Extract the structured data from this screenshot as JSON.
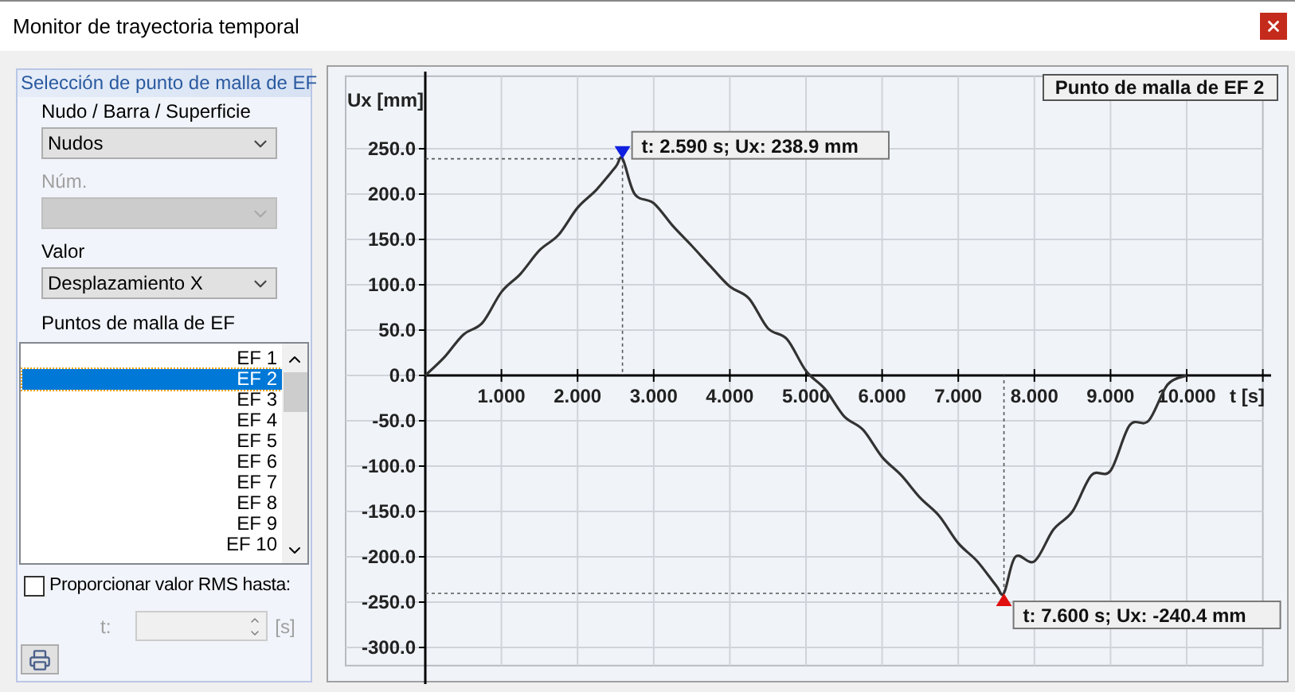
{
  "window": {
    "title": "Monitor de trayectoria temporal"
  },
  "selection_panel": {
    "title": "Selección de punto de malla de EF",
    "fields": [
      {
        "label": "Nudo / Barra / Superficie",
        "value": "Nudos",
        "disabled": false
      },
      {
        "label": "Núm.",
        "disabled": true
      },
      {
        "label": "Valor",
        "value": "Desplazamiento X",
        "disabled": false
      }
    ],
    "list_label": "Puntos de malla de EF",
    "points": [
      {
        "label": "EF 1",
        "selected": false
      },
      {
        "label": "EF 2",
        "selected": true
      },
      {
        "label": "EF 3",
        "selected": false
      },
      {
        "label": "EF 4",
        "selected": false
      },
      {
        "label": "EF 5",
        "selected": false
      },
      {
        "label": "EF 6",
        "selected": false
      },
      {
        "label": "EF 7",
        "selected": false
      },
      {
        "label": "EF 8",
        "selected": false
      },
      {
        "label": "EF 9",
        "selected": false
      },
      {
        "label": "EF 10",
        "selected": false
      }
    ],
    "rms": {
      "label": "Proporcionar valor RMS hasta:",
      "checked": false,
      "field_label": "t:",
      "unit": "[s]",
      "disabled": true
    }
  },
  "chart_panel": {
    "chart_data": {
      "type": "line",
      "title": "Punto de malla de EF 2",
      "xlabel": "t [s]",
      "ylabel": "Ux [mm]",
      "x": [
        0,
        0.25,
        0.5,
        0.75,
        1.0,
        1.25,
        1.5,
        1.75,
        2.0,
        2.25,
        2.5,
        2.59,
        2.75,
        3.0,
        3.25,
        3.5,
        3.75,
        4.0,
        4.25,
        4.5,
        4.75,
        5.0,
        5.25,
        5.5,
        5.75,
        6.0,
        6.25,
        6.5,
        6.75,
        7.0,
        7.25,
        7.5,
        7.6,
        7.75,
        8.0,
        8.25,
        8.5,
        8.75,
        9.0,
        9.25,
        9.5,
        9.75,
        10.0
      ],
      "grid": true,
      "series": [
        {
          "color": "#333333",
          "values": [
            0,
            20,
            45,
            58,
            92,
            112,
            138,
            155,
            185,
            205,
            230,
            239,
            200,
            190,
            165,
            143,
            120,
            98,
            85,
            52,
            40,
            5,
            -15,
            -45,
            -60,
            -90,
            -110,
            -135,
            -155,
            -185,
            -205,
            -232,
            -240,
            -200,
            -205,
            -170,
            -150,
            -110,
            -105,
            -55,
            -50,
            -10,
            0
          ]
        }
      ],
      "xlim": [
        0,
        11
      ],
      "ylim": [
        -320,
        330
      ],
      "xticks": [
        {
          "value": 1,
          "label": "1.000"
        },
        {
          "value": 2,
          "label": "2.000"
        },
        {
          "value": 3,
          "label": "3.000"
        },
        {
          "value": 4,
          "label": "4.000"
        },
        {
          "value": 5,
          "label": "5.000"
        },
        {
          "value": 6,
          "label": "6.000"
        },
        {
          "value": 7,
          "label": "7.000"
        },
        {
          "value": 8,
          "label": "8.000"
        },
        {
          "value": 9,
          "label": "9.000"
        },
        {
          "value": 10,
          "label": "10.000"
        }
      ],
      "yticks": [
        {
          "value": 250,
          "label": "250.0"
        },
        {
          "value": 200,
          "label": "200.0"
        },
        {
          "value": 150,
          "label": "150.0"
        },
        {
          "value": 100,
          "label": "100.0"
        },
        {
          "value": 50,
          "label": "50.0"
        },
        {
          "value": 0,
          "label": "0.0"
        },
        {
          "value": -50,
          "label": "-50.0"
        },
        {
          "value": -100,
          "label": "-100.0"
        },
        {
          "value": -150,
          "label": "-150.0"
        },
        {
          "value": -200,
          "label": "-200.0"
        },
        {
          "value": -250,
          "label": "-250.0"
        },
        {
          "value": -300,
          "label": "-300.0"
        }
      ],
      "annotations": [
        {
          "x": 2.59,
          "y": 238.9,
          "text": "t: 2.590 s; Ux: 238.9 mm"
        },
        {
          "x": 7.6,
          "y": -240.4,
          "text": "t: 7.600 s; Ux: -240.4 mm"
        }
      ]
    }
  }
}
